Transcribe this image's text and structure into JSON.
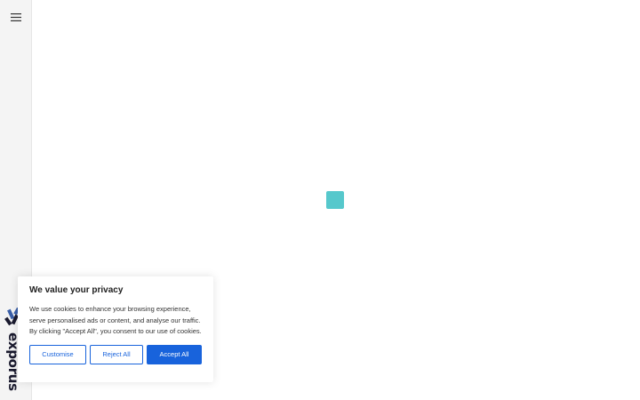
{
  "brand": {
    "name": "exporus"
  },
  "cookie_banner": {
    "title": "We value your privacy",
    "text": "We use cookies to enhance your browsing experience, serve personalised ads or content, and analyse our traffic. By clicking \"Accept All\", you consent to our use of cookies.",
    "buttons": {
      "customise": "Customise",
      "reject": "Reject All",
      "accept": "Accept All"
    }
  },
  "icons": {
    "menu": "hamburger-menu-icon",
    "logo": "brand-logo-icon"
  },
  "colors": {
    "accent": "#1863dc",
    "loader": "#56c8cc",
    "sidebar_bg": "#f4f4f4",
    "brand_dark": "#1a1a2e",
    "brand_blue": "#3a5fa8"
  }
}
